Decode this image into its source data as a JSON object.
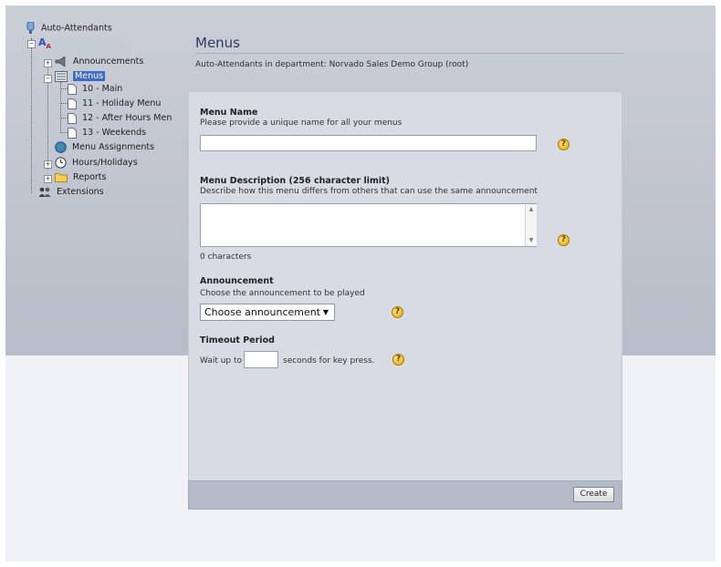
{
  "tree": {
    "root": "Auto-Attendants",
    "items": [
      {
        "label": "Announcements"
      },
      {
        "label": "Menus"
      },
      {
        "label": "10 - Main"
      },
      {
        "label": "11 - Holiday Menu"
      },
      {
        "label": "12 - After Hours Men"
      },
      {
        "label": "13 - Weekends"
      },
      {
        "label": "Menu Assignments"
      },
      {
        "label": "Hours/Holidays"
      },
      {
        "label": "Reports"
      },
      {
        "label": "Extensions"
      }
    ]
  },
  "header": {
    "title": "Menus",
    "subtitle": "Auto-Attendants in department: Norvado Sales Demo Group (root)"
  },
  "form": {
    "menu_name": {
      "label": "Menu Name",
      "description": "Please provide a unique name for all your menus",
      "value": ""
    },
    "menu_description": {
      "label": "Menu Description (256 character limit)",
      "description": "Describe how this menu differs from others that can use the same announcement",
      "value": "",
      "counter": "0 characters"
    },
    "announcement": {
      "label": "Announcement",
      "description": "Choose the announcement to be played",
      "selected": "Choose announcement"
    },
    "timeout": {
      "label": "Timeout Period",
      "prefix": "Wait up to",
      "suffix": "seconds for key press.",
      "value": ""
    },
    "help_glyph": "?",
    "create_label": "Create"
  },
  "colors": {
    "selected_bg": "#3d6bc6",
    "band": "#c1c7d1",
    "panel": "#d7dbe3",
    "footer": "#b5bbc6"
  }
}
